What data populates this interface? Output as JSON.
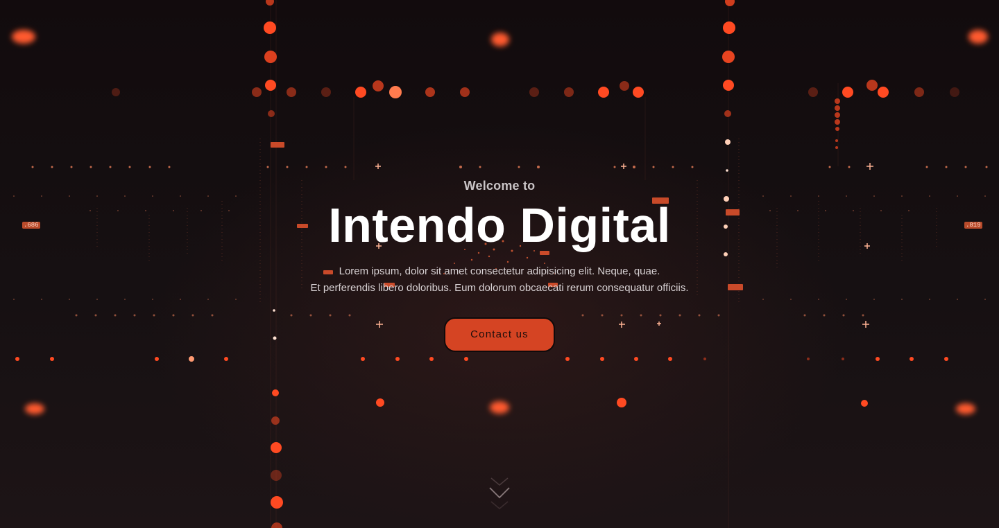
{
  "hero": {
    "eyebrow": "Welcome to",
    "title": "Intendo Digital",
    "subtitle_line1": "Lorem ipsum, dolor sit amet consectetur adipisicing elit. Neque, quae.",
    "subtitle_line2": "Et perferendis libero doloribus. Eum dolorum obcaecati rerum consequatur officiis.",
    "cta_label": "Contact us",
    "side_label_left": ".686",
    "side_label_right": ".819"
  },
  "colors": {
    "background": "#140d0f",
    "accent": "#d54423",
    "glow": "#ff5a2e",
    "title": "#ffffff",
    "text": "#d8d2d4"
  },
  "icons": {
    "scroll": "chevron-down-icon"
  }
}
